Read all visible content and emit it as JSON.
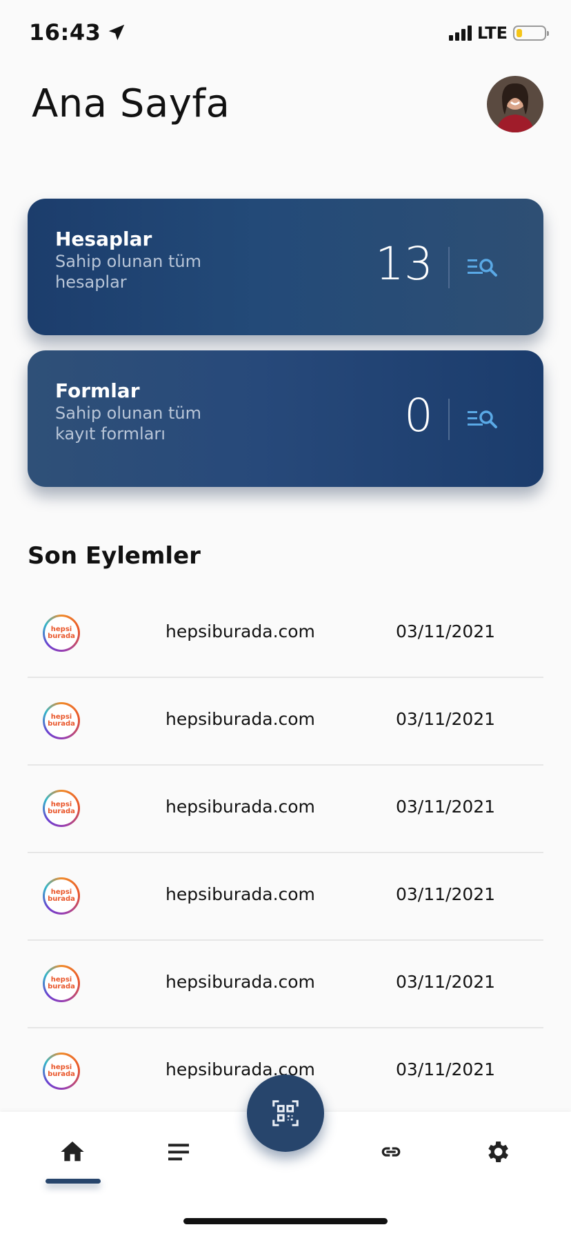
{
  "status": {
    "time": "16:43",
    "network": "LTE",
    "battery_level": 0.2
  },
  "header": {
    "title": "Ana Sayfa"
  },
  "cards": [
    {
      "title": "Hesaplar",
      "subtitle": "Sahip olunan tüm hesaplar",
      "count": "13"
    },
    {
      "title": "Formlar",
      "subtitle": "Sahip olunan tüm kayıt formları",
      "count": "0"
    }
  ],
  "recent": {
    "title": "Son Eylemler",
    "items": [
      {
        "logo_text_1": "hepsi",
        "logo_text_2": "burada",
        "domain": "hepsiburada.com",
        "date": "03/11/2021"
      },
      {
        "logo_text_1": "hepsi",
        "logo_text_2": "burada",
        "domain": "hepsiburada.com",
        "date": "03/11/2021"
      },
      {
        "logo_text_1": "hepsi",
        "logo_text_2": "burada",
        "domain": "hepsiburada.com",
        "date": "03/11/2021"
      },
      {
        "logo_text_1": "hepsi",
        "logo_text_2": "burada",
        "domain": "hepsiburada.com",
        "date": "03/11/2021"
      },
      {
        "logo_text_1": "hepsi",
        "logo_text_2": "burada",
        "domain": "hepsiburada.com",
        "date": "03/11/2021"
      },
      {
        "logo_text_1": "hepsi",
        "logo_text_2": "burada",
        "domain": "hepsiburada.com",
        "date": "03/11/2021"
      }
    ]
  },
  "nav": {
    "items": [
      "home-icon",
      "list-icon",
      "qr-scan-icon",
      "link-icon",
      "settings-icon"
    ],
    "active": "home-icon"
  },
  "colors": {
    "primary": "#27456c",
    "card_dark": "#1c3d6c",
    "accent_icon": "#5aa9e6"
  }
}
